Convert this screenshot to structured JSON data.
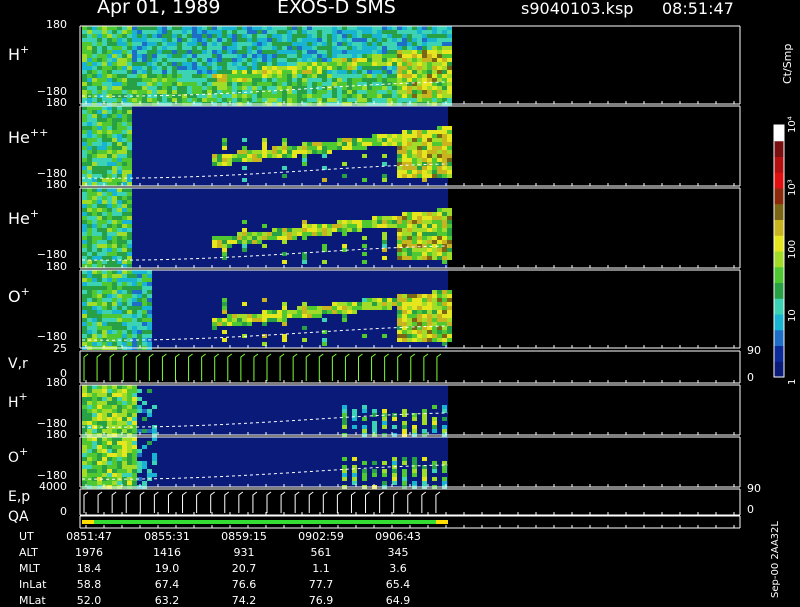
{
  "header": {
    "date": "Apr 01, 1989",
    "instrument": "EXOS-D SMS",
    "file": "s9040103.ksp",
    "time": "08:51:47"
  },
  "colors": {
    "background": "#000000",
    "axis": "#ffffff",
    "noise_floor": "#0a1a78",
    "no_data": "#000000",
    "dashed_trace": "#ffffff",
    "velocity_ticks": "#7dff3a",
    "qa_bar_ok": "#ffdd00",
    "qa_bar_good": "#33dd33"
  },
  "colorbar": {
    "title": "Ct/Smp",
    "scale": "log",
    "range": [
      1,
      10000
    ],
    "tick_labels": [
      "1",
      "10",
      "100",
      "10³",
      "10⁴"
    ],
    "tick_values": [
      1,
      10,
      100,
      1000,
      10000
    ],
    "colors": [
      "#0a1a78",
      "#0d2a9a",
      "#1e6ec8",
      "#19b4d2",
      "#3cd2b4",
      "#28a046",
      "#50c832",
      "#a0dc28",
      "#e6e61e",
      "#c8b41e",
      "#7a6614",
      "#8a2a0a",
      "#e01010",
      "#b41010",
      "#781010",
      "#ffffff"
    ]
  },
  "time_axis": {
    "start": "08:51:47",
    "end": "09:06:43",
    "data_end": "09:08:30",
    "tick_labels": [
      "0851:47",
      "0855:31",
      "0859:15",
      "0902:59",
      "0906:43"
    ]
  },
  "ephemeris": {
    "rows": [
      {
        "label": "UT",
        "values": [
          "0851:47",
          "0855:31",
          "0859:15",
          "0902:59",
          "0906:43"
        ]
      },
      {
        "label": "ALT",
        "values": [
          "1976",
          "1416",
          "931",
          "561",
          "345"
        ]
      },
      {
        "label": "MLT",
        "values": [
          "18.4",
          "19.0",
          "20.7",
          "1.1",
          "3.6"
        ]
      },
      {
        "label": "InLat",
        "values": [
          "58.8",
          "67.4",
          "76.6",
          "77.7",
          "65.4"
        ]
      },
      {
        "label": "MLat",
        "values": [
          "52.0",
          "63.2",
          "74.2",
          "76.9",
          "64.9"
        ]
      }
    ]
  },
  "footer": {
    "text": "Sep-00 2AA32L"
  },
  "chart_data": {
    "type": "heatmap",
    "title": "Apr 01, 1989   EXOS-D SMS",
    "x_unit": "UT",
    "panels": [
      {
        "id": "h-plus",
        "label": "H",
        "sup": "+",
        "type": "heatmap",
        "ylim": [
          -180,
          180
        ],
        "y_tick_labels": [
          "180",
          "−180"
        ],
        "band_near_minus180": true,
        "dashed_trace": true
      },
      {
        "id": "he-plus-plus",
        "label": "He",
        "sup": "++",
        "type": "heatmap",
        "ylim": [
          -180,
          180
        ],
        "y_tick_labels": [
          "180",
          "−180"
        ],
        "band_near_minus180": true,
        "dashed_trace": true
      },
      {
        "id": "he-plus",
        "label": "He",
        "sup": "+",
        "type": "heatmap",
        "ylim": [
          -180,
          180
        ],
        "y_tick_labels": [
          "180",
          "−180"
        ],
        "band_near_minus180": true,
        "dashed_trace": true
      },
      {
        "id": "o-plus",
        "label": "O",
        "sup": "+",
        "type": "heatmap",
        "ylim": [
          -180,
          180
        ],
        "y_tick_labels": [
          "180",
          "−180"
        ],
        "band_near_minus180": true,
        "dashed_trace": true
      },
      {
        "id": "v-r",
        "label": "V,r",
        "sup": "",
        "type": "line",
        "ylim": [
          0,
          25
        ],
        "y_tick_labels": [
          "25",
          "0"
        ],
        "right_tick_labels": [
          "90",
          "0"
        ],
        "sweep_count": 28
      },
      {
        "id": "h-plus-2",
        "label": "H",
        "sup": "+",
        "type": "heatmap",
        "ylim": [
          -180,
          180
        ],
        "y_tick_labels": [
          "180",
          "−180"
        ],
        "dashed_trace": true
      },
      {
        "id": "o-plus-2",
        "label": "O",
        "sup": "+",
        "type": "heatmap",
        "ylim": [
          -180,
          180
        ],
        "y_tick_labels": [
          "180",
          "−180"
        ],
        "dashed_trace": true
      },
      {
        "id": "e-p",
        "label": "E,p",
        "sup": "",
        "type": "line",
        "ylim": [
          0,
          4000
        ],
        "y_tick_labels": [
          "4000",
          "0"
        ],
        "right_tick_labels": [
          "90",
          "0"
        ],
        "sweep_count": 26
      },
      {
        "id": "qa",
        "label": "QA",
        "sup": "",
        "type": "flag"
      }
    ]
  }
}
